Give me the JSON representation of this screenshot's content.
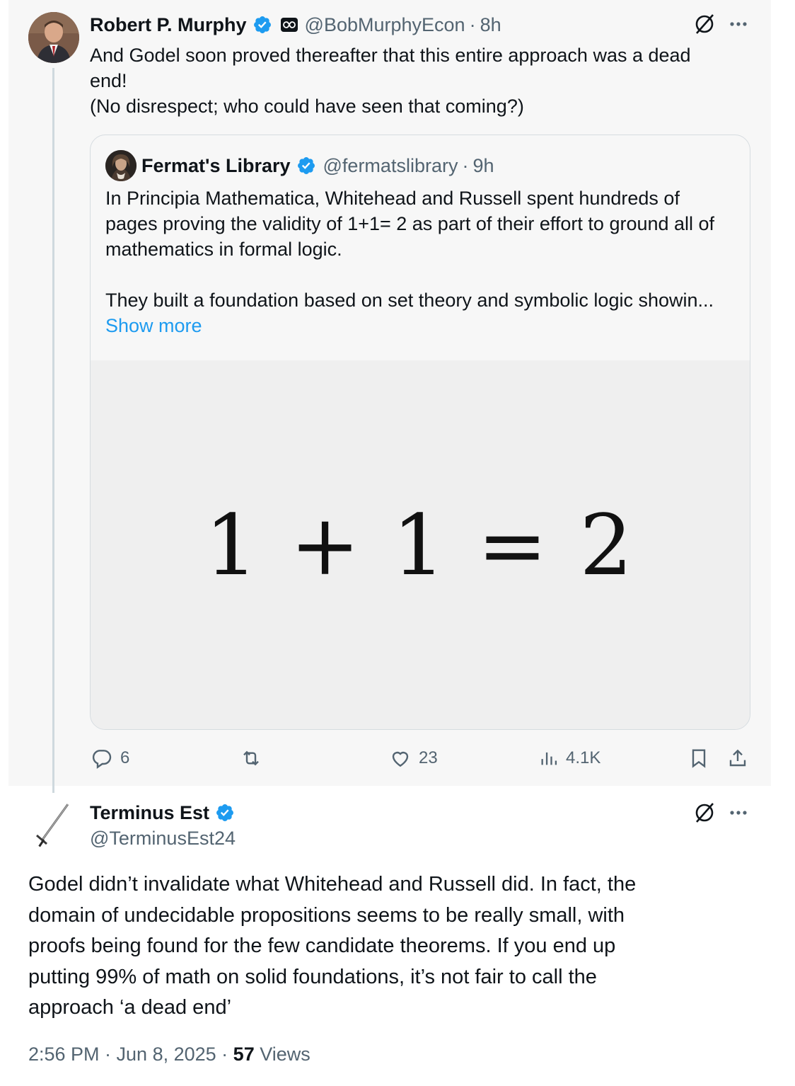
{
  "parent_tweet": {
    "author_name": "Robert P. Murphy",
    "handle": "@BobMurphyEcon",
    "time": "8h",
    "text_line1": "And Godel soon proved thereafter that this entire approach was a dead",
    "text_line2": "end!",
    "text_line3": "(No disrespect; who could have seen that coming?)",
    "quoted": {
      "author_name": "Fermat's Library",
      "handle": "@fermatslibrary",
      "time": "9h",
      "para1_line1": "In Principia Mathematica, Whitehead and Russell spent hundreds of",
      "para1_line2": "pages proving the validity of 1+1= 2 as part of their effort to ground all of",
      "para1_line3": "mathematics in formal logic.",
      "para2_line1": "They built a foundation based on set theory and symbolic logic showin...",
      "show_more": "Show more",
      "media_text": "1 + 1 = 2"
    },
    "actions": {
      "replies": "6",
      "likes": "23",
      "views": "4.1K"
    }
  },
  "reply_tweet": {
    "author_name": "Terminus Est",
    "handle": "@TerminusEst24",
    "text_line1": "Godel didn’t invalidate what Whitehead and Russell did. In fact, the",
    "text_line2": "domain of undecidable propositions seems to be really small, with",
    "text_line3": "proofs being found for the few candidate theorems.  If you end up",
    "text_line4": "putting 99% of math on solid foundations, it’s not fair to call the",
    "text_line5": "approach ‘a dead end’",
    "timestamp": "2:56 PM · Jun 8, 2025 · ",
    "views_count": "57",
    "views_label": " Views"
  },
  "colors": {
    "verified": "#1d9bf0",
    "link": "#1d9bf0",
    "muted": "#536471",
    "text": "#0f1419"
  }
}
